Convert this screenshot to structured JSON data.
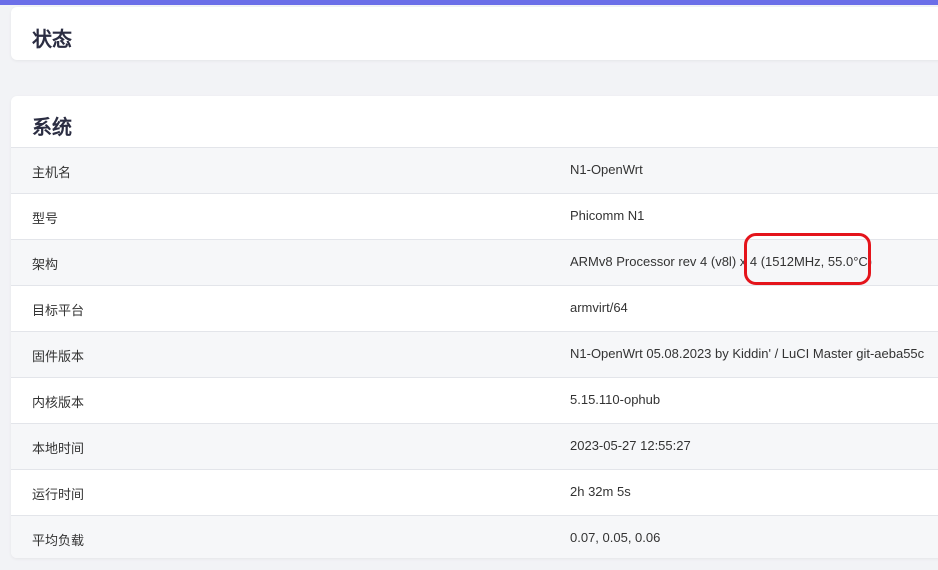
{
  "page": {
    "title": "状态"
  },
  "system": {
    "title": "系统",
    "rows": [
      {
        "label": "主机名",
        "value": "N1-OpenWrt"
      },
      {
        "label": "型号",
        "value": "Phicomm N1"
      },
      {
        "label": "架构",
        "value": "ARMv8 Processor rev 4 (v8l) x 4 (1512MHz, 55.0°C)"
      },
      {
        "label": "目标平台",
        "value": "armvirt/64"
      },
      {
        "label": "固件版本",
        "value": "N1-OpenWrt 05.08.2023 by Kiddin' / LuCI Master git-aeba55c"
      },
      {
        "label": "内核版本",
        "value": "5.15.110-ophub"
      },
      {
        "label": "本地时间",
        "value": "2023-05-27 12:55:27"
      },
      {
        "label": "运行时间",
        "value": "2h 32m 5s"
      },
      {
        "label": "平均负载",
        "value": "0.07, 0.05, 0.06"
      }
    ]
  },
  "colors": {
    "accent": "#6b6ee8",
    "highlight": "#e4141b"
  }
}
